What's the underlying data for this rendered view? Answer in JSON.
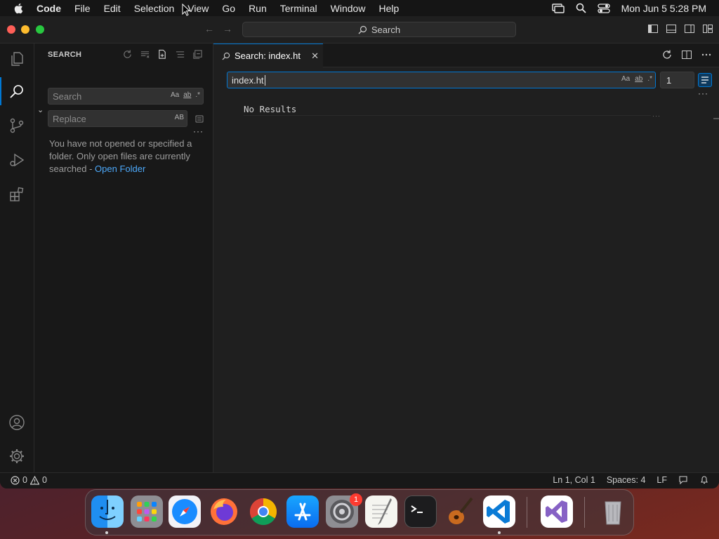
{
  "menubar": {
    "app": "Code",
    "items": [
      "File",
      "Edit",
      "Selection",
      "View",
      "Go",
      "Run",
      "Terminal",
      "Window",
      "Help"
    ],
    "clock": "Mon Jun 5  5:28 PM"
  },
  "titlebar": {
    "search_label": "Search"
  },
  "sidebar": {
    "title": "SEARCH",
    "search_placeholder": "Search",
    "replace_placeholder": "Replace",
    "opt_case": "Aa",
    "opt_word": "ab",
    "opt_regex": ".*",
    "opt_preserve_case": "AB",
    "message": "You have not opened or specified a folder. Only open files are currently searched - ",
    "open_folder": "Open Folder"
  },
  "editor": {
    "tab_label": "Search: index.ht",
    "query": "index.ht",
    "context_lines": "1",
    "no_results": "No Results"
  },
  "statusbar": {
    "errors": "0",
    "warnings": "0",
    "position": "Ln 1, Col 1",
    "spaces": "Spaces: 4",
    "eol": "LF"
  },
  "dock": {
    "apps": [
      "Finder",
      "Launchpad",
      "Safari",
      "Firefox",
      "Chrome",
      "App Store",
      "System Settings",
      "TextEdit",
      "Terminal",
      "GarageBand",
      "Visual Studio Code",
      "Visual Studio",
      "Trash"
    ],
    "settings_badge": "1"
  },
  "colors": {
    "accent": "#0078d4",
    "link": "#4daafc",
    "editor_bg": "#1f1f1f",
    "sidebar_bg": "#181818"
  }
}
